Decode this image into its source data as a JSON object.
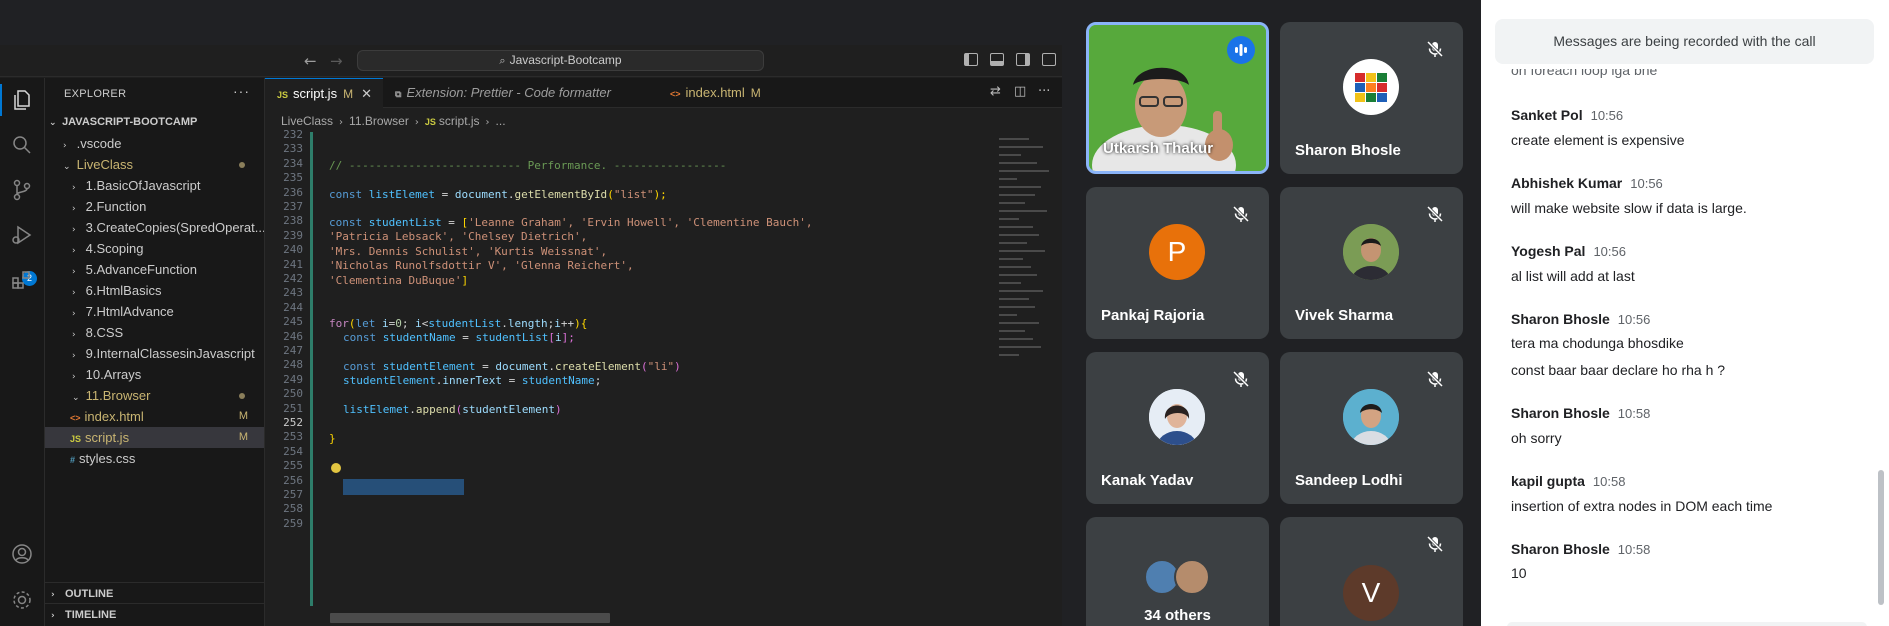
{
  "vscode": {
    "search_text": "Javascript-Bootcamp",
    "explorer": {
      "title": "EXPLORER",
      "root": "JAVASCRIPT-BOOTCAMP",
      "items": [
        {
          "label": ".vscode"
        },
        {
          "label": "LiveClass"
        },
        {
          "label": "1.BasicOfJavascript"
        },
        {
          "label": "2.Function"
        },
        {
          "label": "3.CreateCopies(SpredOperat..."
        },
        {
          "label": "4.Scoping"
        },
        {
          "label": "5.AdvanceFunction"
        },
        {
          "label": "6.HtmlBasics"
        },
        {
          "label": "7.HtmlAdvance"
        },
        {
          "label": "8.CSS"
        },
        {
          "label": "9.InternalClassesinJavascript"
        },
        {
          "label": "10.Arrays"
        },
        {
          "label": "11.Browser"
        },
        {
          "label": "index.html",
          "badge": "M"
        },
        {
          "label": "script.js",
          "badge": "M"
        },
        {
          "label": "styles.css"
        }
      ],
      "outline": "OUTLINE",
      "timeline": "TIMELINE"
    },
    "scm_badge": "2",
    "tabs": [
      {
        "label": "script.js",
        "badge": "M"
      },
      {
        "label": "Extension: Prettier - Code formatter"
      },
      {
        "label": "index.html",
        "badge": "M"
      }
    ],
    "breadcrumb": [
      "LiveClass",
      "11.Browser",
      "script.js",
      "..."
    ],
    "line_numbers": [
      "232",
      "233",
      "234",
      "235",
      "236",
      "237",
      "238",
      "239",
      "240",
      "241",
      "242",
      "243",
      "244",
      "245",
      "246",
      "247",
      "248",
      "249",
      "250",
      "251",
      "252",
      "253",
      "254",
      "255",
      "256",
      "257",
      "258",
      "259"
    ],
    "code": {
      "l233": "// -------------------------- Performance. -----------------",
      "l237": [
        "const",
        " ",
        "listElemet",
        " = ",
        "document",
        ".",
        "getElementById",
        "(",
        "\"list\"",
        ");"
      ],
      "l239": [
        "const",
        " ",
        "studentList",
        " = ",
        "[",
        "'Leanne Graham', 'Ervin Howell', 'Clementine Bauch',"
      ],
      "l240": "'Patricia Lebsack', 'Chelsey Dietrich',",
      "l241": "'Mrs. Dennis Schulist', 'Kurtis Weissnat',",
      "l242": "'Nicholas Runolfsdottir V', 'Glenna Reichert',",
      "l243": [
        "'Clementina DuBuque'",
        "]"
      ],
      "l246": [
        "for",
        "(",
        "let",
        " ",
        "i",
        "=",
        "0",
        "; ",
        "i",
        "<",
        "studentList",
        ".",
        "length",
        ";",
        "i",
        "++",
        ")",
        "{"
      ],
      "l247": [
        "const",
        " ",
        "studentName",
        " = ",
        "studentList",
        "[",
        "i",
        "];"
      ],
      "l249": [
        "const",
        " ",
        "studentElement",
        " = ",
        "document",
        ".",
        "createElement",
        "(",
        "\"li\"",
        ")"
      ],
      "l250": [
        "studentElement",
        ".",
        "innerText",
        " = ",
        "studentName",
        ";"
      ],
      "l252": [
        "listElemet",
        ".",
        "append",
        "(",
        "studentElement",
        ")"
      ],
      "l254": "}"
    }
  },
  "participants": [
    {
      "name": "Utkarsh Thakur"
    },
    {
      "name": "Sharon Bhosle"
    },
    {
      "name": "Pankaj Rajoria",
      "initial": "P",
      "color": "#e8710a"
    },
    {
      "name": "Vivek Sharma"
    },
    {
      "name": "Kanak Yadav"
    },
    {
      "name": "Sandeep Lodhi"
    },
    {
      "name": "34 others"
    },
    {
      "initial": "V",
      "color": "#5d3a2a"
    }
  ],
  "chat": {
    "banner": "Messages are being recorded with the call",
    "partial_text": "on foreach loop iga bhe",
    "messages": [
      {
        "sender": "Sanket Pol",
        "time": "10:56",
        "lines": [
          "create element is expensive"
        ]
      },
      {
        "sender": "Abhishek Kumar",
        "time": "10:56",
        "lines": [
          "will make website slow if data is large."
        ]
      },
      {
        "sender": "Yogesh Pal",
        "time": "10:56",
        "lines": [
          "al list will add at last"
        ]
      },
      {
        "sender": "Sharon Bhosle",
        "time": "10:56",
        "lines": [
          "tera ma chodunga bhosdike",
          "const baar baar declare ho rha h ?"
        ]
      },
      {
        "sender": "Sharon Bhosle",
        "time": "10:58",
        "lines": [
          "oh sorry"
        ]
      },
      {
        "sender": "kapil gupta",
        "time": "10:58",
        "lines": [
          "insertion of extra nodes in DOM each time"
        ]
      },
      {
        "sender": "Sharon Bhosle",
        "time": "10:58",
        "lines": [
          "10"
        ]
      }
    ]
  }
}
